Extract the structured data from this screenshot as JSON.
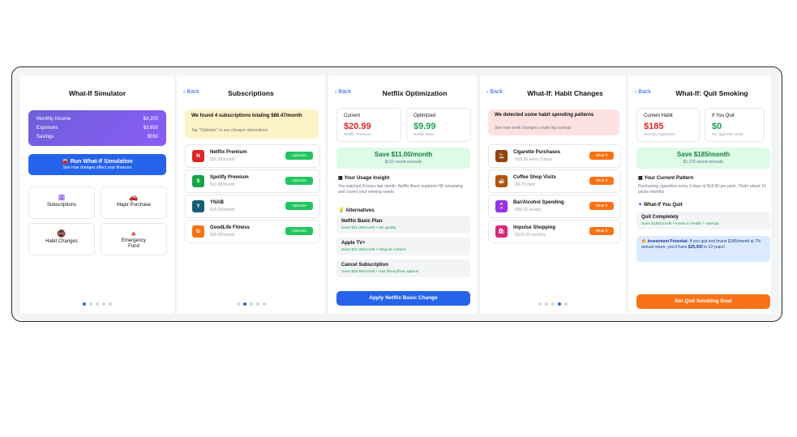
{
  "s1": {
    "title": "What-If Simulator",
    "summary": [
      {
        "label": "Monthly Income",
        "value": "$4,200"
      },
      {
        "label": "Expenses",
        "value": "$3,650"
      },
      {
        "label": "Savings",
        "value": "$550"
      }
    ],
    "run_button": {
      "label": "Run What-If Simulation",
      "sub": "See how changes affect your finances",
      "icon": "🚘"
    },
    "tiles": [
      {
        "label": "Subscriptions",
        "icon": "▦"
      },
      {
        "label": "Major Purchase",
        "icon": "🚗"
      },
      {
        "label": "Habit Changes",
        "icon": "🚭"
      },
      {
        "label": "Emergency\nFund",
        "icon": "🔺"
      }
    ]
  },
  "s2": {
    "back": "‹ Back",
    "title": "Subscriptions",
    "banner": {
      "title": "We found 4 subscriptions totaling $86.47/month",
      "sub": "Tap \"Optimize\" to see cheaper alternatives"
    },
    "items": [
      {
        "badge": "N",
        "name": "Netflix Premium",
        "price": "$20.99/month",
        "action": "Optimize",
        "color": "#dc2626"
      },
      {
        "badge": "S",
        "name": "Spotify Premium",
        "price": "$10.99/month",
        "action": "Optimize",
        "color": "#16a34a"
      },
      {
        "badge": "Y",
        "name": "YNAB",
        "price": "$14.00/month",
        "action": "Optimize",
        "color": "#155e75"
      },
      {
        "badge": "G",
        "name": "GoodLife Fitness",
        "price": "$39.49/month",
        "action": "Optimize",
        "color": "#f97316"
      }
    ]
  },
  "s3": {
    "back": "‹ Back",
    "title": "Netflix Optimization",
    "current": {
      "label": "Current",
      "value": "$20.99",
      "plan": "Netflix Premium"
    },
    "optimized": {
      "label": "Optimized",
      "value": "$9.99",
      "plan": "Netflix Basic"
    },
    "save": {
      "title": "Save $11.00/month",
      "sub": "$132 saved annually"
    },
    "insight_title": "Your Usage Insight",
    "insight_text": "You watched 8 hours last month. Netflix Basic supports HD streaming and covers your viewing needs.",
    "alternatives_title": "Alternatives",
    "alternatives": [
      {
        "title": "Netflix Basic Plan",
        "desc": "Save $11.00/month • HD quality"
      },
      {
        "title": "Apple TV+",
        "desc": "Save $12.00/month • Original content"
      },
      {
        "title": "Cancel Subscription",
        "desc": "Save $20.99/month • Use library/free options"
      }
    ],
    "apply_button": "Apply Netflix Basic Change"
  },
  "s4": {
    "back": "‹ Back",
    "title": "What-If: Habit Changes",
    "banner": {
      "title": "We detected some habit spending patterns",
      "sub": "See how small changes create big savings"
    },
    "items": [
      {
        "icon": "🚬",
        "name": "Cigarette Purchases",
        "detail": "~$18.50 every 3 days",
        "action": "What If",
        "color": "#92400e"
      },
      {
        "icon": "☕",
        "name": "Coffee Shop Visits",
        "detail": "~$6.75 daily",
        "action": "What If",
        "color": "#b45309"
      },
      {
        "icon": "🍷",
        "name": "Bar/Alcohol Spending",
        "detail": "~$85.00 weekly",
        "action": "What If",
        "color": "#9333ea"
      },
      {
        "icon": "🛍",
        "name": "Impulse Shopping",
        "detail": "~$120.00 monthly",
        "action": "What If",
        "color": "#db2777"
      }
    ]
  },
  "s5": {
    "back": "‹ Back",
    "title": "What-If: Quit Smoking",
    "current": {
      "label": "Current Habit",
      "value": "$185",
      "sub": "Monthly cigarettes"
    },
    "quit": {
      "label": "If You Quit",
      "value": "$0",
      "sub": "No cigarette costs"
    },
    "save": {
      "title": "Save $185/month",
      "sub": "$2,220 saved annually"
    },
    "pattern_title": "Your Current Pattern",
    "pattern_text": "Purchasing cigarettes every 3 days at $18.50 per pack. That's about 10 packs monthly.",
    "whatif_title": "What-If You Quit",
    "quit_option": {
      "title": "Quit Completely",
      "desc": "Save $185/month • Invest in health + savings"
    },
    "investment": {
      "label": "Investment Potential:",
      "text": "If you quit and invest $185/month at 7% annual return, you'd have",
      "amount": "$25,000",
      "tail": "in 10 years!"
    },
    "goal_button": "Set Quit Smoking Goal"
  },
  "colors": {
    "accent": "#2563eb",
    "green": "#16a34a",
    "red": "#dc2626",
    "orange": "#f97316"
  }
}
